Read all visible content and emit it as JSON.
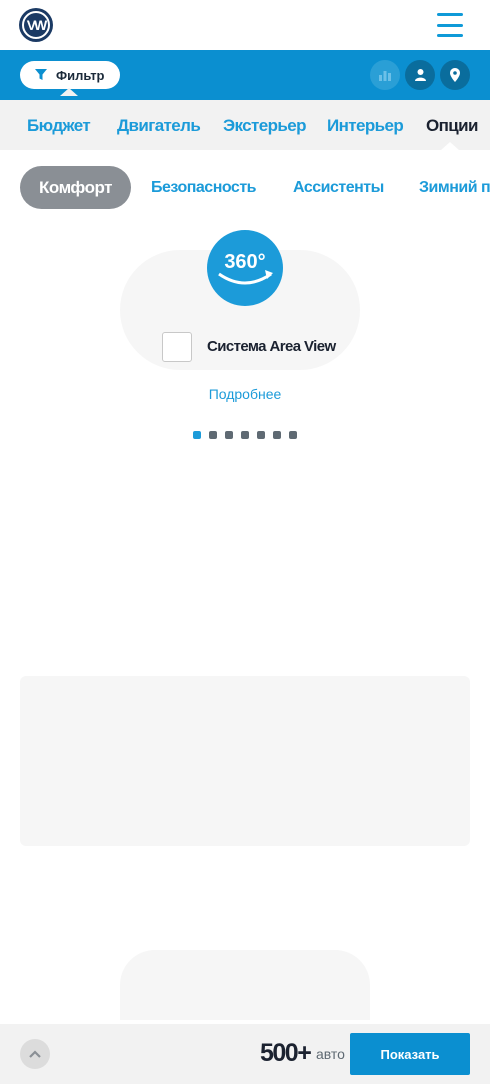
{
  "header": {
    "logo": "VW",
    "menu_icon": "hamburger-menu-icon"
  },
  "filterbar": {
    "filter_label": "Фильтр",
    "buttons": [
      "chart-icon",
      "user-icon",
      "map-pin-icon"
    ]
  },
  "categories": [
    {
      "label": "Бюджет",
      "active": false
    },
    {
      "label": "Двигатель",
      "active": false
    },
    {
      "label": "Экстерьер",
      "active": false
    },
    {
      "label": "Интерьер",
      "active": false
    },
    {
      "label": "Опции",
      "active": true
    }
  ],
  "subcategories": [
    {
      "label": "Комфорт",
      "active": true
    },
    {
      "label": "Безопасность",
      "active": false
    },
    {
      "label": "Ассистенты",
      "active": false
    },
    {
      "label": "Зимний пакет",
      "active": false
    }
  ],
  "option": {
    "icon_text": "360°",
    "label": "Система Area View",
    "checked": false,
    "more_link": "Подробнее"
  },
  "pagination": {
    "total": 7,
    "active_index": 0
  },
  "bottombar": {
    "count": "500+",
    "unit": "авто",
    "show_label": "Показать"
  },
  "colors": {
    "accent": "#0b8fd0",
    "text_link": "#1c9bd9",
    "dark_text": "#1b2230",
    "chip_active": "#8a8f95"
  }
}
